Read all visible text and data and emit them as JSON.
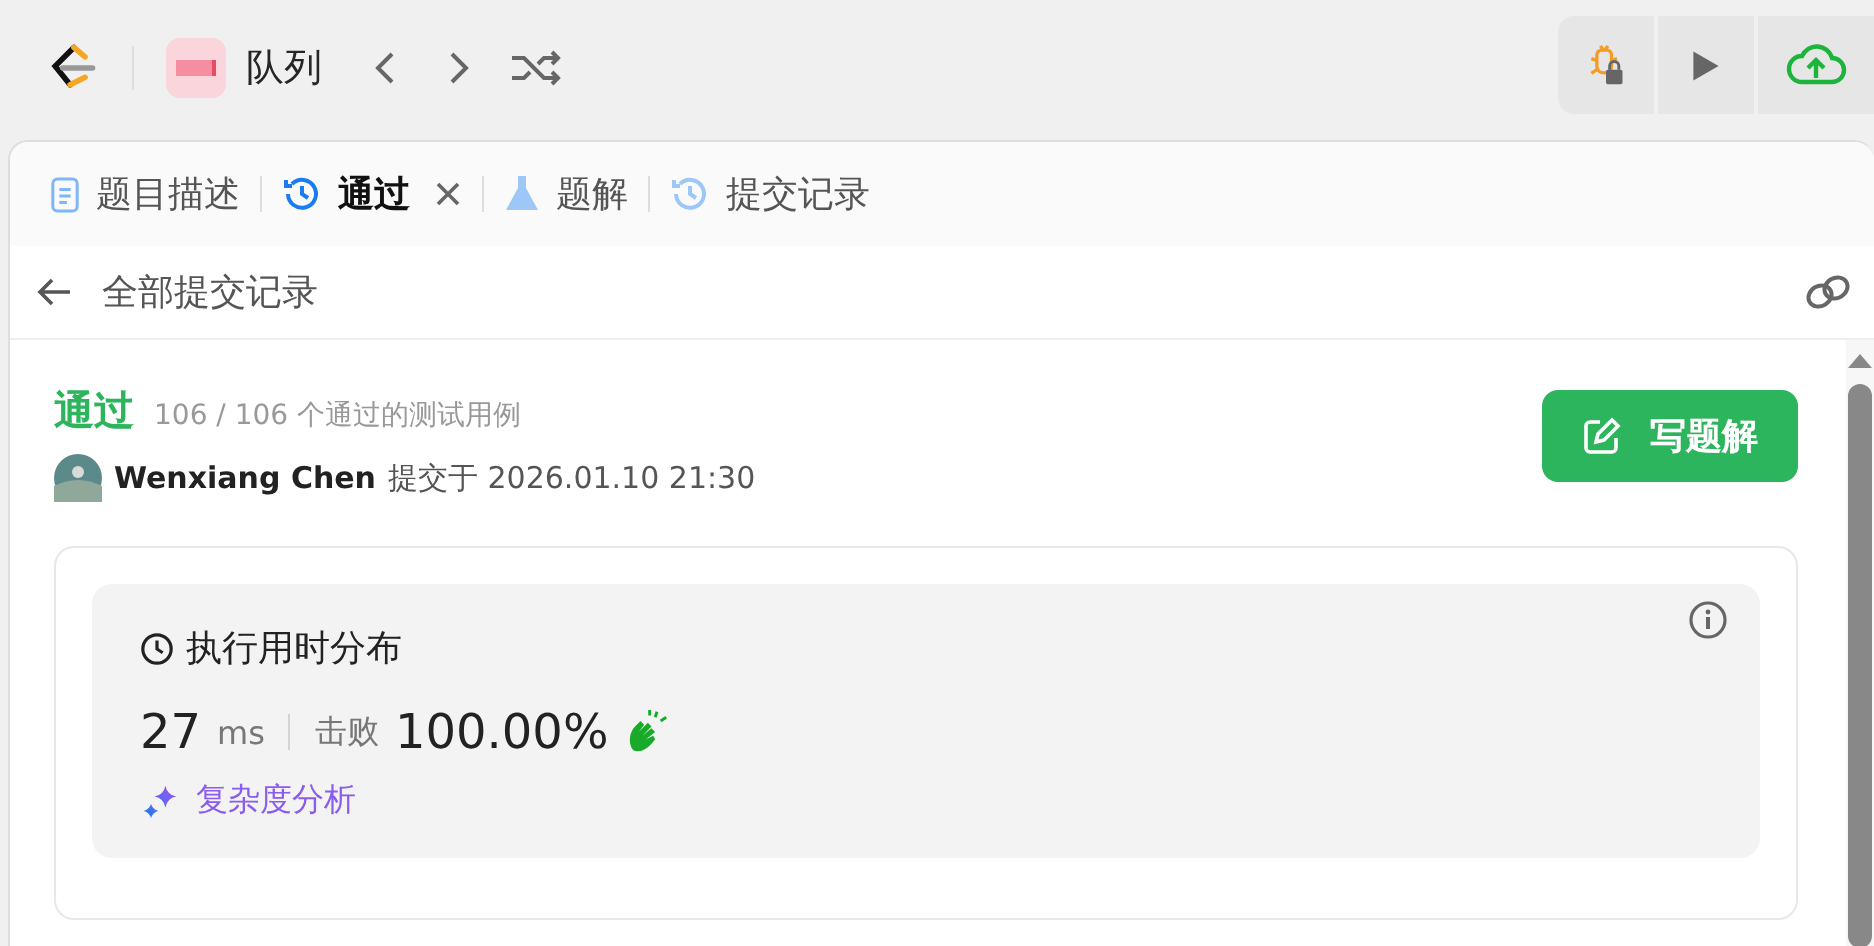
{
  "topbar": {
    "title": "队列"
  },
  "tabs": [
    {
      "label": "题目描述",
      "kind": "doc",
      "selected": false,
      "closable": false
    },
    {
      "label": "通过",
      "kind": "history",
      "selected": true,
      "closable": true
    },
    {
      "label": "题解",
      "kind": "flask",
      "selected": false,
      "closable": false
    },
    {
      "label": "提交记录",
      "kind": "history",
      "selected": false,
      "closable": false
    }
  ],
  "header": {
    "back_label": "全部提交记录"
  },
  "result": {
    "status": "通过",
    "cases": "106 / 106 个通过的测试用例",
    "author": "Wenxiang Chen",
    "submitted": "提交于 2026.01.10 21:30",
    "write_button": "写题解"
  },
  "runtime": {
    "title": "执行用时分布",
    "value": "27",
    "unit": "ms",
    "beats_label": "击败",
    "beats": "100.00%",
    "analysis_link": "复杂度分析"
  }
}
